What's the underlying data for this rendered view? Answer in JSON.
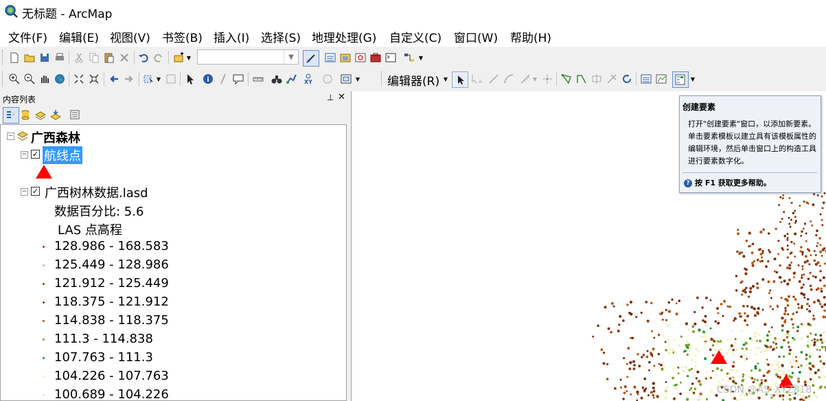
{
  "window": {
    "title": "无标题 - ArcMap",
    "icon": "arcmap-globe-icon"
  },
  "menubar": {
    "items": [
      "文件(F)",
      "编辑(E)",
      "视图(V)",
      "书签(B)",
      "插入(I)",
      "选择(S)",
      "地理处理(G)",
      "自定义(C)",
      "窗口(W)",
      "帮助(H)"
    ]
  },
  "toolbar": {
    "scale_value": "",
    "editor_label": "编辑器(R)"
  },
  "toc": {
    "title": "内容列表",
    "group_name": "广西森林",
    "layer1_name": "航线点",
    "layer2_name": "广西树林数据.lasd",
    "percent_label": "数据百分比: 5.6",
    "elevation_label": "LAS 点高程",
    "legend": [
      {
        "label": "128.986 - 168.583",
        "color": "#d81b1b"
      },
      {
        "label": "125.449 - 128.986",
        "color": "#b8b8b8"
      },
      {
        "label": "121.912 - 125.449",
        "color": "#8b3a0f"
      },
      {
        "label": "118.375 - 121.912",
        "color": "#7a2a0a"
      },
      {
        "label": "114.838 - 118.375",
        "color": "#b5560f"
      },
      {
        "label": "111.3 - 114.838",
        "color": "#7fa02a"
      },
      {
        "label": "107.763 - 111.3",
        "color": "#1d8f2d"
      },
      {
        "label": "104.226 - 107.763",
        "color": "#f2f2c2"
      },
      {
        "label": "100.689 - 104.226",
        "color": "#cfe8e8"
      }
    ]
  },
  "tooltip": {
    "title": "创建要素",
    "body": "打开\"创建要素\"窗口，以添加新要素。单击要素模板以建立具有该模板属性的编辑环境，然后单击窗口上的构造工具进行要素数字化。",
    "help": "按 F1 获取更多帮助。"
  },
  "watermark": "CSDN @AS_XYZ818"
}
